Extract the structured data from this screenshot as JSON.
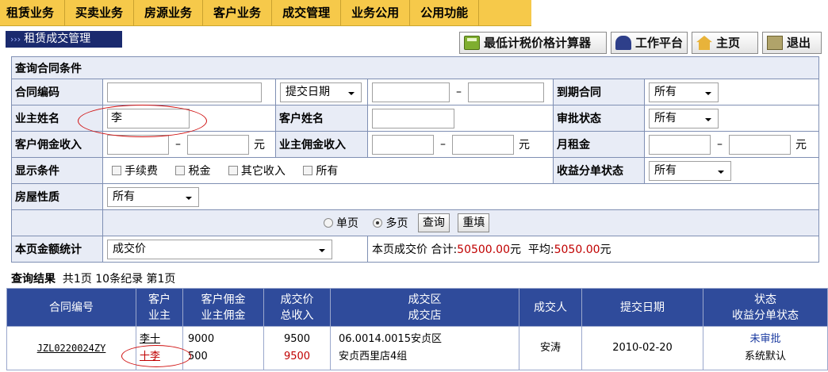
{
  "menu": [
    "租赁业务",
    "买卖业务",
    "房源业务",
    "客户业务",
    "成交管理",
    "业务公用",
    "公用功能"
  ],
  "page_title": "租赁成交管理",
  "top_buttons": {
    "calculator": "最低计税价格计算器",
    "workbench": "工作平台",
    "home": "主页",
    "exit": "退出"
  },
  "query": {
    "section_title": "查询合同条件",
    "contract_no_label": "合同编码",
    "contract_no_value": "",
    "date_type_select": "提交日期",
    "date_dash": "–",
    "expire_label": "到期合同",
    "expire_select": "所有",
    "owner_name_label": "业主姓名",
    "owner_name_value": "李",
    "customer_name_label": "客户姓名",
    "customer_name_value": "",
    "approval_label": "审批状态",
    "approval_select": "所有",
    "cust_commission_label": "客户佣金收入",
    "owner_commission_label": "业主佣金收入",
    "monthly_rent_label": "月租金",
    "yuan": "元",
    "display_label": "显示条件",
    "display_options": [
      "手续费",
      "税金",
      "其它收入",
      "所有"
    ],
    "profit_split_label": "收益分单状态",
    "profit_split_select": "所有",
    "property_type_label": "房屋性质",
    "property_type_select": "所有",
    "radio_single": "单页",
    "radio_multi": "多页",
    "search_button": "查询",
    "reset_button": "重填",
    "stats_label": "本页金额统计",
    "stats_select": "成交价",
    "stats_text_prefix": "本页成交价 合计:",
    "stats_total": "50500.00",
    "stats_text_mid": "元  平均:",
    "stats_avg": "5050.00",
    "stats_text_suffix": "元"
  },
  "result": {
    "label": "查询结果",
    "summary": "共1页 10条纪录 第1页",
    "headers": [
      [
        "合同编号"
      ],
      [
        "客户",
        "业主"
      ],
      [
        "客户佣金",
        "业主佣金"
      ],
      [
        "成交价",
        "总收入"
      ],
      [
        "成交区",
        "成交店"
      ],
      [
        "成交人"
      ],
      [
        "提交日期"
      ],
      [
        "状态",
        "收益分单状态"
      ]
    ],
    "rows": [
      {
        "contract_no": "JZL0220024ZY",
        "customer": "李十",
        "owner": "十李",
        "cust_commission": "9000",
        "owner_commission": "500",
        "price": "9500",
        "income": "9500",
        "area": "06.0014.0015安贞区",
        "store": "安贞西里店4组",
        "agent": "安涛",
        "date": "2010-02-20",
        "status": "未审批",
        "split_status": "系统默认"
      }
    ]
  },
  "colors": {
    "menu_bg": "#f6c94a",
    "title_bg": "#1a2a6e",
    "table_header_bg": "#2f4b9b",
    "label_bg": "#e8ecf6",
    "highlight_red": "#c00000",
    "annotation_red": "#d01010"
  }
}
